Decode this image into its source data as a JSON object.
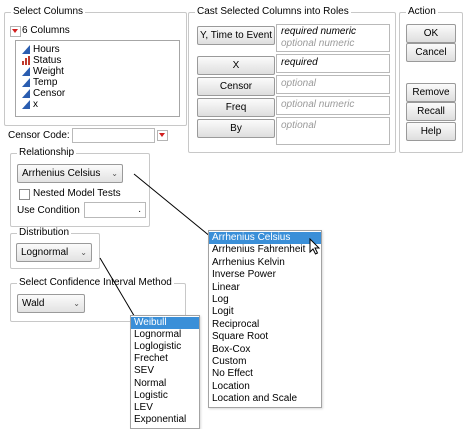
{
  "select_columns": {
    "title": "Select Columns",
    "count_label": "6 Columns",
    "columns": [
      {
        "name": "Hours",
        "icon": "continuous-icon"
      },
      {
        "name": "Status",
        "icon": "nominal-icon"
      },
      {
        "name": "Weight",
        "icon": "continuous-icon"
      },
      {
        "name": "Temp",
        "icon": "continuous-icon"
      },
      {
        "name": "Censor",
        "icon": "continuous-icon"
      },
      {
        "name": "x",
        "icon": "continuous-icon"
      }
    ]
  },
  "cast_roles": {
    "title": "Cast Selected Columns into Roles",
    "roles": [
      {
        "button": "Y, Time to Event",
        "hint1": "required numeric",
        "hint2": "optional numeric"
      },
      {
        "button": "X",
        "hint1": "required",
        "hint2": ""
      },
      {
        "button": "Censor",
        "hint1": "optional",
        "hint2": ""
      },
      {
        "button": "Freq",
        "hint1": "optional numeric",
        "hint2": ""
      },
      {
        "button": "By",
        "hint1": "optional",
        "hint2": ""
      }
    ]
  },
  "action": {
    "title": "Action",
    "ok": "OK",
    "cancel": "Cancel",
    "remove": "Remove",
    "recall": "Recall",
    "help": "Help"
  },
  "censor_code": {
    "label": "Censor Code:",
    "value": ""
  },
  "relationship": {
    "title": "Relationship",
    "selected": "Arrhenius Celsius",
    "nested_label": "Nested Model Tests",
    "use_condition_label": "Use Condition",
    "use_condition_value": "."
  },
  "distribution": {
    "title": "Distribution",
    "selected": "Lognormal"
  },
  "confidence": {
    "title": "Select Confidence Interval Method",
    "selected": "Wald"
  },
  "relationship_popup": {
    "items": [
      "Arrhenius Celsius",
      "Arrhenius Fahrenheit",
      "Arrhenius Kelvin",
      "Inverse Power",
      "Linear",
      "Log",
      "Logit",
      "Reciprocal",
      "Square Root",
      "Box-Cox",
      "Custom",
      "No Effect",
      "Location",
      "Location and Scale"
    ],
    "selected_index": 0
  },
  "distribution_popup": {
    "items": [
      "Weibull",
      "Lognormal",
      "Loglogistic",
      "Frechet",
      "SEV",
      "Normal",
      "Logistic",
      "LEV",
      "Exponential"
    ],
    "selected_index": 0
  },
  "colors": {
    "accent": "#3a8fd8",
    "red_triangle": "#d21f1f",
    "continuous_icon": "#2a5db0",
    "nominal_icon": "#c0392b"
  }
}
